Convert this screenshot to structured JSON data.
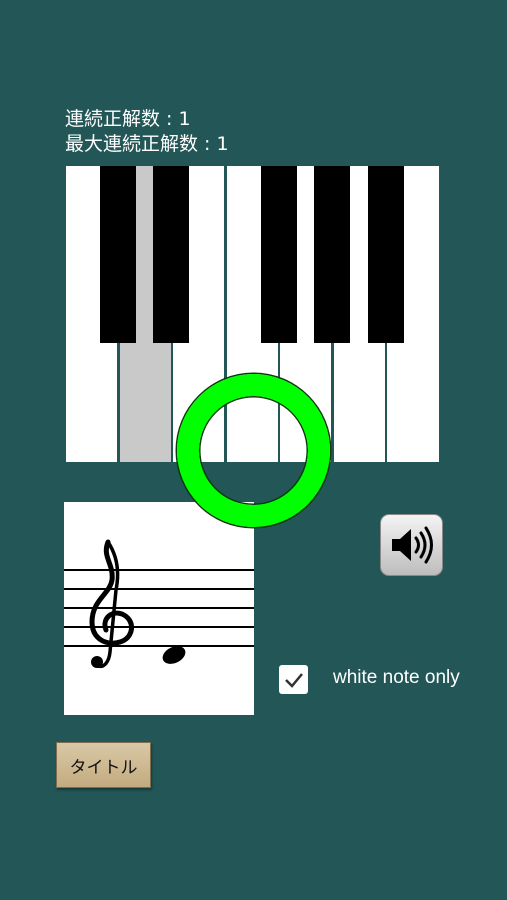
{
  "stats": {
    "current_streak_label": "連続正解数 : 1",
    "max_streak_label": "最大連続正解数 : 1"
  },
  "keyboard": {
    "white_keys": [
      "white-key-1",
      "white-key-2",
      "white-key-3",
      "white-key-4",
      "white-key-5",
      "white-key-6",
      "white-key-7"
    ],
    "black_keys": [
      "black-key-1",
      "black-key-2",
      "black-key-3",
      "black-key-4",
      "black-key-5"
    ],
    "highlighted_key": "white-key-2"
  },
  "feedback": {
    "result": "correct",
    "ring_color": "#00ff00"
  },
  "options": {
    "white_note_only_label": "white note only",
    "white_note_only_checked": true
  },
  "buttons": {
    "title_label": "タイトル"
  },
  "icons": {
    "sound": "speaker-icon",
    "check": "check-icon",
    "clef": "treble-clef-icon"
  },
  "colors": {
    "background": "#225657",
    "highlight_key": "#c9c9c9",
    "ring": "#00ff00"
  }
}
